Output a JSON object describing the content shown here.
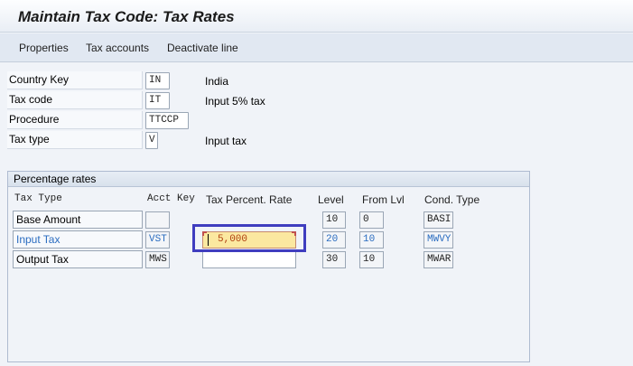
{
  "title": "Maintain Tax Code: Tax Rates",
  "toolbar": {
    "properties": "Properties",
    "tax_accounts": "Tax accounts",
    "deactivate_line": "Deactivate line"
  },
  "header": {
    "country_key": {
      "label": "Country Key",
      "value": "IN",
      "description": "India"
    },
    "tax_code": {
      "label": "Tax code",
      "value": "IT",
      "description": "Input 5% tax"
    },
    "procedure": {
      "label": "Procedure",
      "value": "TTCCP"
    },
    "tax_type": {
      "label": "Tax type",
      "value": "V",
      "description": "Input tax"
    }
  },
  "rates": {
    "group_title": "Percentage rates",
    "columns": {
      "tax_type": "Tax Type",
      "acct_key": "Acct Key",
      "tax_percent_rate": "Tax Percent. Rate",
      "level": "Level",
      "from_lvl": "From Lvl",
      "cond_type": "Cond. Type"
    },
    "rows": [
      {
        "tax_type": "Base Amount",
        "acct_key": "",
        "rate": "",
        "level": "10",
        "from_lvl": "0",
        "cond_type": "BASI"
      },
      {
        "tax_type": "Input Tax",
        "acct_key": "VST",
        "rate": "5,000",
        "level": "20",
        "from_lvl": "10",
        "cond_type": "MWVY"
      },
      {
        "tax_type": "Output Tax",
        "acct_key": "MWS",
        "rate": "",
        "level": "30",
        "from_lvl": "10",
        "cond_type": "MWAR"
      }
    ]
  },
  "colors": {
    "highlight_text": "#2a6cc0",
    "active_field_bg": "#fbe8a0",
    "focus_frame": "#3f3dbf"
  }
}
